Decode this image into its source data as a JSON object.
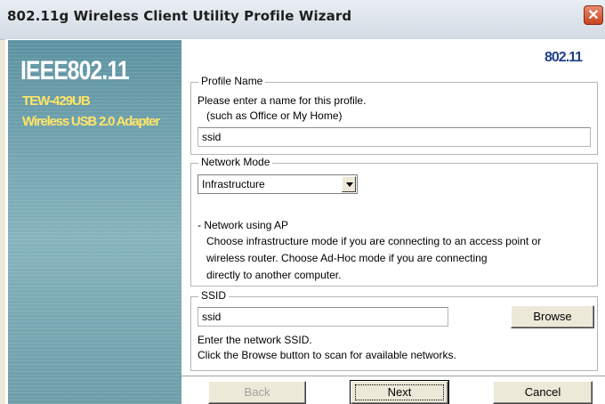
{
  "window": {
    "title": "802.11g Wireless Client Utility Profile Wizard",
    "close_glyph": "✕"
  },
  "sidebar": {
    "brand": "IEEE802.11",
    "model": "TEW-429UB",
    "description": "Wireless USB 2.0 Adapter"
  },
  "header_logo": "802.11",
  "profile_name": {
    "legend": "Profile Name",
    "line1": "Please enter a name for this profile.",
    "line2": "(such as Office or My Home)",
    "value": "ssid"
  },
  "network_mode": {
    "legend": "Network Mode",
    "selected": "Infrastructure",
    "desc_title": "- Network using AP",
    "desc_line1": "Choose infrastructure mode if you are connecting to an access point or",
    "desc_line2": "wireless router. Choose Ad-Hoc mode if you are connecting",
    "desc_line3": "directly to another computer."
  },
  "ssid": {
    "legend": "SSID",
    "value": "ssid",
    "browse_label": "Browse",
    "help1": "Enter the network SSID.",
    "help2": "Click the Browse button to scan for available networks."
  },
  "buttons": {
    "back": "Back",
    "next": "Next",
    "cancel": "Cancel"
  }
}
